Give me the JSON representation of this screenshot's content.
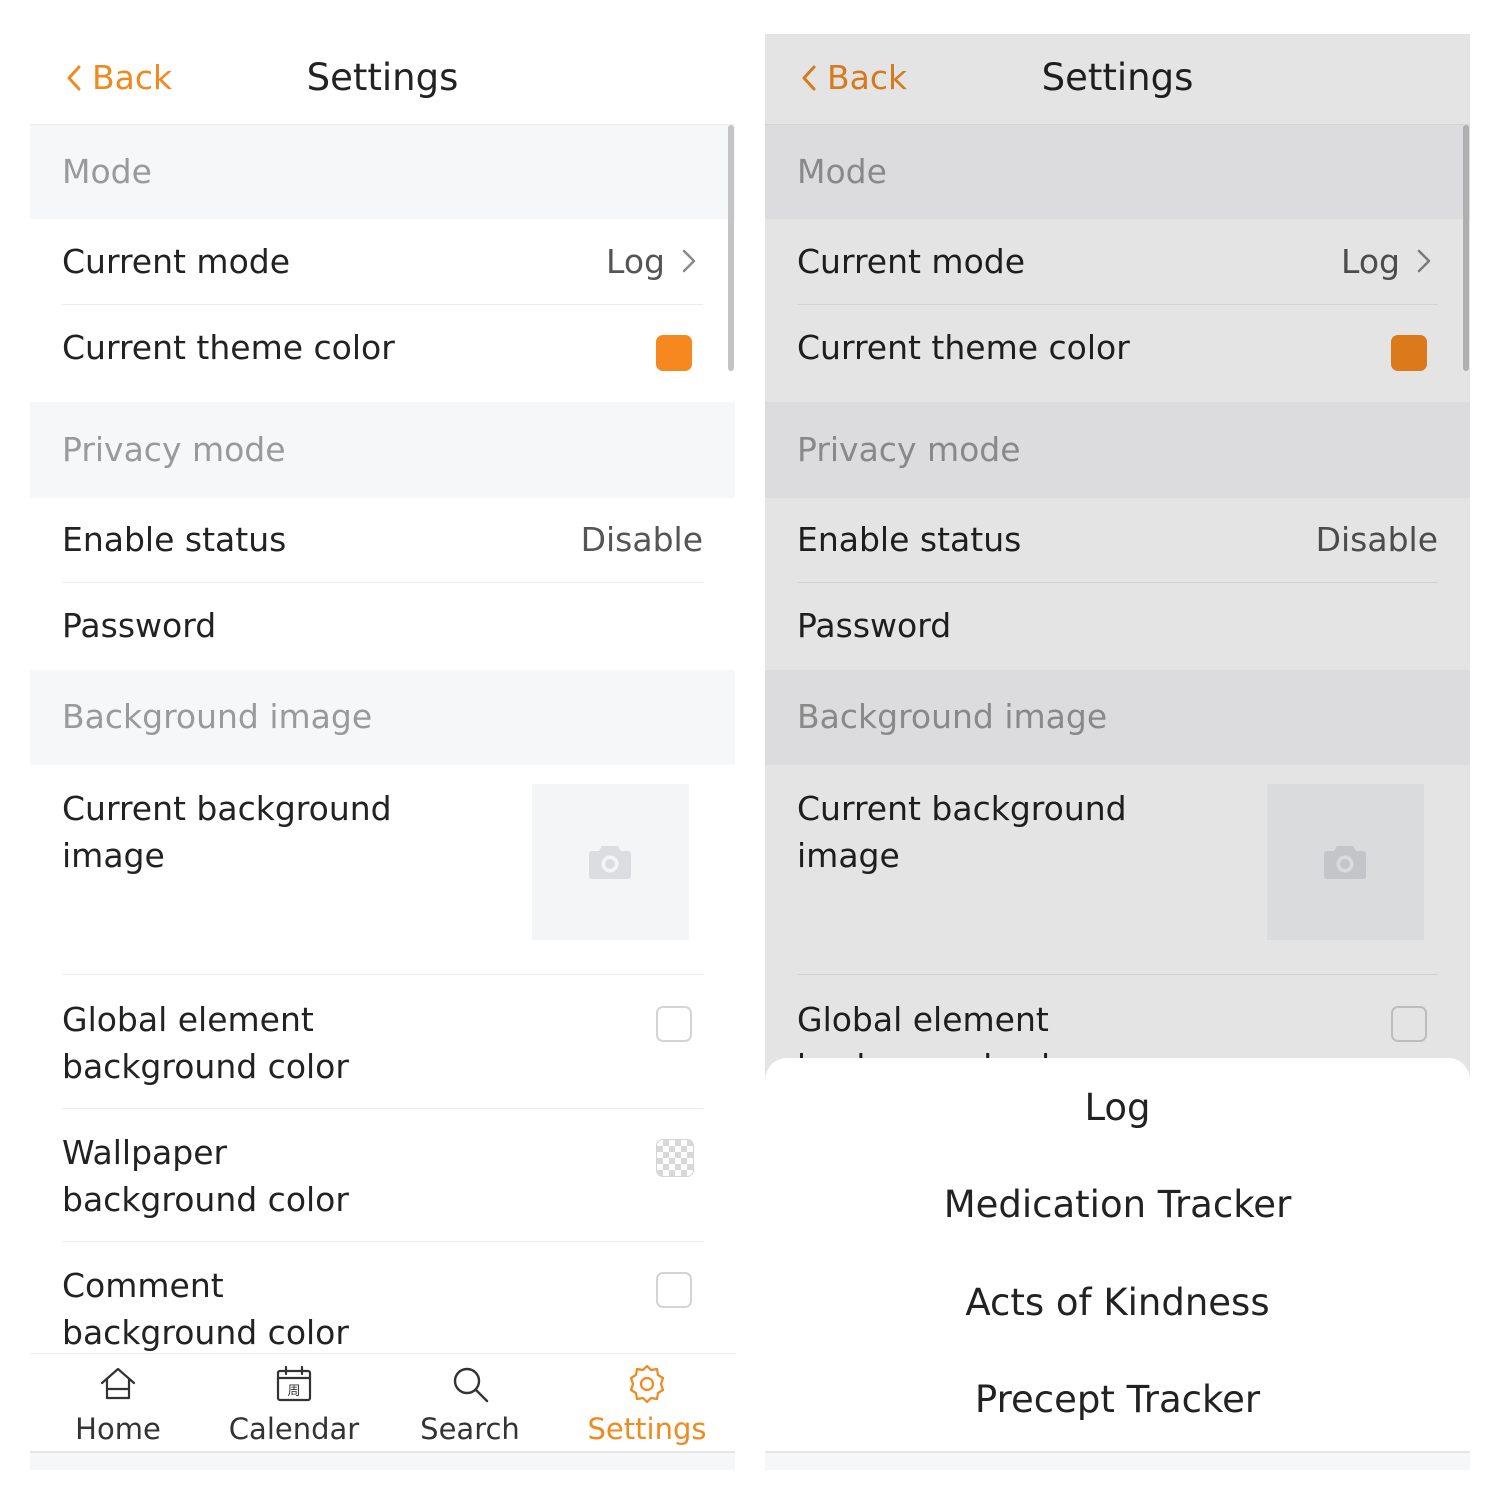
{
  "nav": {
    "back_label": "Back",
    "title": "Settings"
  },
  "sections": {
    "mode": "Mode",
    "privacy": "Privacy mode",
    "background": "Background image"
  },
  "rows": {
    "current_mode": {
      "label": "Current mode",
      "value": "Log"
    },
    "theme_color": {
      "label": "Current theme color",
      "color": "#f7881f"
    },
    "enable_status": {
      "label": "Enable status",
      "value": "Disable"
    },
    "password": {
      "label": "Password"
    },
    "bg_image": {
      "label_line1": "Current background",
      "label_line2": "image"
    },
    "global_element": {
      "label_line1": "Global element",
      "label_line2": "background color"
    },
    "wallpaper": {
      "label_line1": "Wallpaper",
      "label_line2": "background color"
    },
    "comment": {
      "label_line1": "Comment",
      "label_line2": "background color"
    }
  },
  "tabbar": {
    "home": "Home",
    "calendar": "Calendar",
    "calendar_glyph": "周",
    "search": "Search",
    "settings": "Settings"
  },
  "mode_picker": {
    "options": [
      "Log",
      "Medication Tracker",
      "Acts of Kindness",
      "Precept Tracker"
    ]
  },
  "colors": {
    "accent": "#ef8a1f",
    "section_bg": "#f6f7f9",
    "dim_overlay": "rgba(0,0,0,0.105)"
  }
}
